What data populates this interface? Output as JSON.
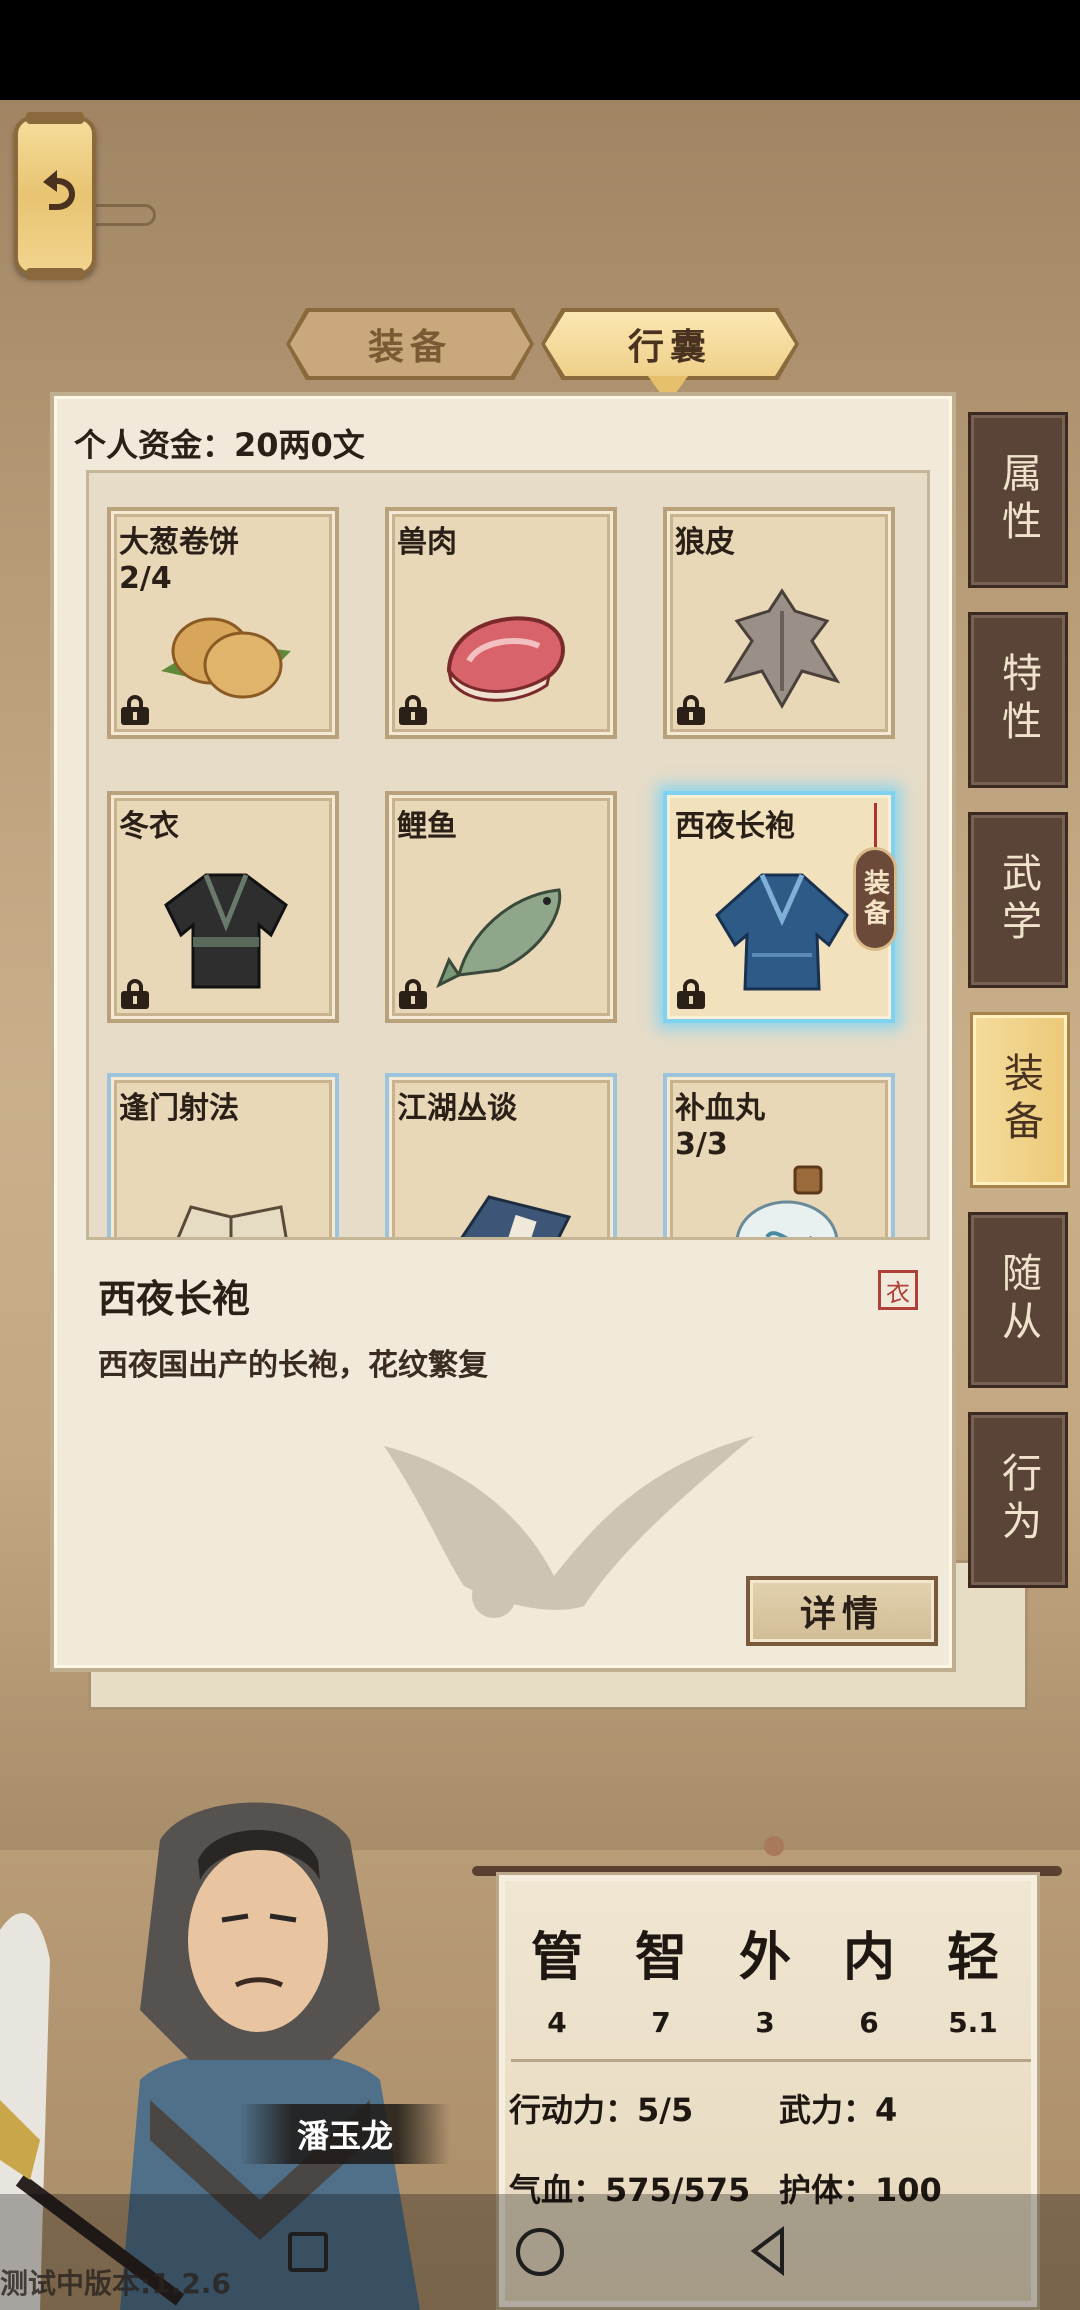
{
  "header": {
    "back_icon": "back-arrow-icon",
    "tabs": [
      {
        "label": "装备",
        "active": false
      },
      {
        "label": "行囊",
        "active": true
      }
    ]
  },
  "bag": {
    "funds_label": "个人资金：20两0文",
    "items": [
      {
        "name": "大葱卷饼",
        "count": "2/4",
        "icon": "scallion-pancake-icon",
        "locked": true
      },
      {
        "name": "兽肉",
        "count": "",
        "icon": "meat-icon",
        "locked": true
      },
      {
        "name": "狼皮",
        "count": "",
        "icon": "wolf-pelt-icon",
        "locked": true
      },
      {
        "name": "冬衣",
        "count": "",
        "icon": "winter-robe-icon",
        "locked": true
      },
      {
        "name": "鲤鱼",
        "count": "",
        "icon": "carp-icon",
        "locked": true
      },
      {
        "name": "西夜长袍",
        "count": "",
        "icon": "blue-robe-icon",
        "locked": true,
        "selected": true,
        "equip_tag": "装备"
      },
      {
        "name": "逢门射法",
        "count": "",
        "icon": "book-icon",
        "locked": false
      },
      {
        "name": "江湖丛谈",
        "count": "",
        "icon": "blue-book-icon",
        "locked": false
      },
      {
        "name": "补血丸",
        "count": "3/3",
        "icon": "potion-bottle-icon",
        "locked": false
      }
    ]
  },
  "detail": {
    "title": "西夜长袍",
    "type_badge": "衣",
    "description": "西夜国出产的长袍，花纹繁复",
    "button_label": "详情"
  },
  "side_tabs": [
    {
      "label": "属性",
      "active": false
    },
    {
      "label": "特性",
      "active": false
    },
    {
      "label": "武学",
      "active": false
    },
    {
      "label": "装备",
      "active": true
    },
    {
      "label": "随从",
      "active": false
    },
    {
      "label": "行为",
      "active": false
    }
  ],
  "character": {
    "name": "潘玉龙"
  },
  "stats": {
    "attributes": [
      {
        "char": "管",
        "value": "4"
      },
      {
        "char": "智",
        "value": "7"
      },
      {
        "char": "外",
        "value": "3"
      },
      {
        "char": "内",
        "value": "6"
      },
      {
        "char": "轻",
        "value": "5.1"
      }
    ],
    "action_power": "行动力：5/5",
    "martial_power": "武力：4",
    "hp": "气血：575/575",
    "guard": "护体：100"
  },
  "footer": {
    "version": "测试中版本:1.2.6"
  },
  "colors": {
    "accent_gold": "#efd08a",
    "panel_bg": "#f1eadb",
    "side_tab_dark": "#5a4438",
    "selected_glow": "#7fd2f0"
  }
}
